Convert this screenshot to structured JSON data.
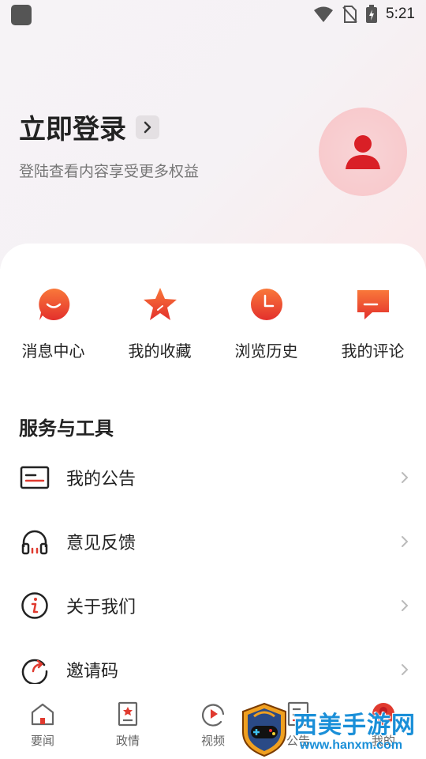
{
  "status_bar": {
    "time": "5:21"
  },
  "profile": {
    "login_title": "立即登录",
    "login_subtitle": "登陆查看内容享受更多权益"
  },
  "quick_actions": [
    {
      "label": "消息中心",
      "icon": "message-icon"
    },
    {
      "label": "我的收藏",
      "icon": "star-icon"
    },
    {
      "label": "浏览历史",
      "icon": "clock-icon"
    },
    {
      "label": "我的评论",
      "icon": "comment-icon"
    }
  ],
  "services": {
    "title": "服务与工具",
    "items": [
      {
        "label": "我的公告",
        "icon": "notice-icon"
      },
      {
        "label": "意见反馈",
        "icon": "headphones-icon"
      },
      {
        "label": "关于我们",
        "icon": "info-icon"
      },
      {
        "label": "邀请码",
        "icon": "invite-icon"
      }
    ]
  },
  "tabbar": {
    "items": [
      {
        "label": "要闻",
        "icon": "home-icon"
      },
      {
        "label": "政情",
        "icon": "bookmark-icon"
      },
      {
        "label": "视频",
        "icon": "video-icon"
      },
      {
        "label": "公告",
        "icon": "notice-icon"
      },
      {
        "label": "我的",
        "icon": "profile-icon"
      }
    ]
  },
  "watermark": {
    "text": "西美手游网",
    "url": "www.hanxm.com"
  },
  "colors": {
    "accent": "#e03a2f",
    "icon_gradient_top": "#f9783a",
    "icon_gradient_bottom": "#e3302c"
  }
}
